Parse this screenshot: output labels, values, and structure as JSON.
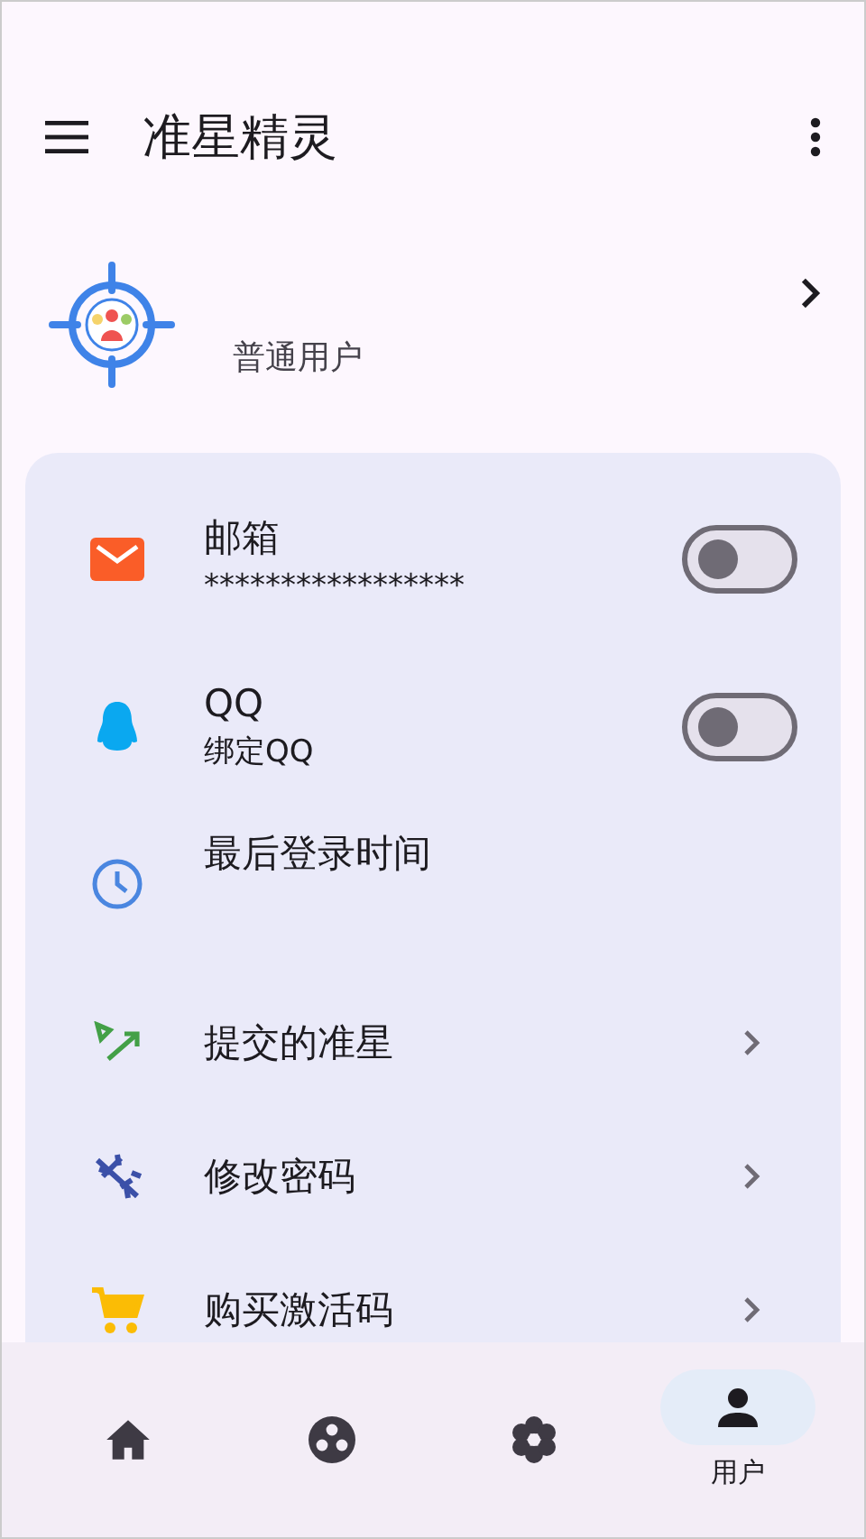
{
  "app_bar": {
    "title": "准星精灵"
  },
  "profile": {
    "user_type": "普通用户"
  },
  "settings": [
    {
      "kind": "toggle",
      "title": "邮箱",
      "subtitle": "*****************",
      "on": false
    },
    {
      "kind": "toggle",
      "title": "QQ",
      "subtitle": "绑定QQ",
      "on": false
    },
    {
      "kind": "info",
      "title": "最后登录时间"
    },
    {
      "kind": "link",
      "title": "提交的准星"
    },
    {
      "kind": "link",
      "title": "修改密码"
    },
    {
      "kind": "link",
      "title": "购买激活码"
    }
  ],
  "bottom_nav": [
    {
      "selected": false
    },
    {
      "selected": false
    },
    {
      "selected": false
    },
    {
      "selected": true,
      "label": "用户"
    }
  ]
}
